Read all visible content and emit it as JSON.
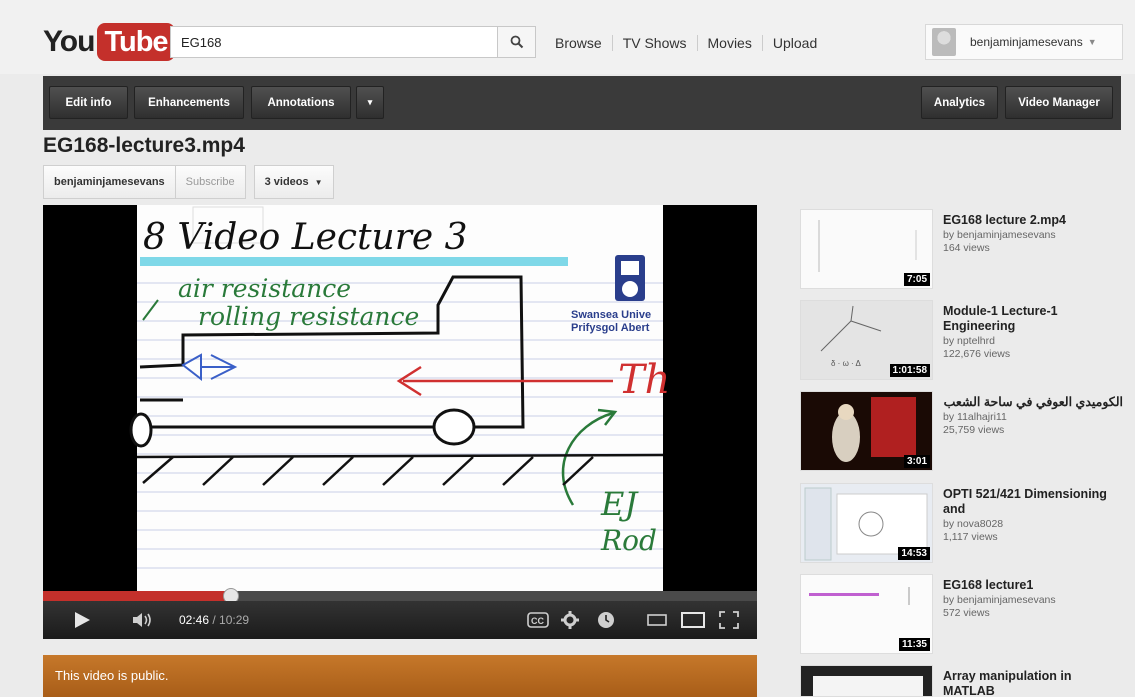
{
  "masthead": {
    "logo_you": "You",
    "logo_tube": "Tube",
    "search_value": "EG168",
    "nav": [
      "Browse",
      "TV Shows",
      "Movies",
      "Upload"
    ],
    "username": "benjaminjamesevans"
  },
  "toolbar": {
    "edit_info": "Edit info",
    "enhancements": "Enhancements",
    "annotations": "Annotations",
    "more_caret": "▾",
    "analytics": "Analytics",
    "video_manager": "Video Manager"
  },
  "video": {
    "title": "EG168-lecture3.mp4",
    "owner": "benjaminjamesevans",
    "subscribe": "Subscribe",
    "videos_count": "3 videos",
    "current_time": "02:46",
    "duration": " / 10:29",
    "progress_fraction": 0.264,
    "frame_text": {
      "heading": "8 Video Lecture 3",
      "line1": "air resistance",
      "line2": "rolling resistance",
      "uni1": "Swansea Unive",
      "uni2": "Prifysgol Abert",
      "th": "Th",
      "ej": "EJ",
      "rod": "Rod"
    },
    "status": "This video is public."
  },
  "related": [
    {
      "title": "EG168 lecture 2.mp4",
      "by": "by benjaminjamesevans",
      "views": "164 views",
      "duration": "7:05"
    },
    {
      "title": "Module-1 Lecture-1 Engineering",
      "by": "by nptelhrd",
      "views": "122,676 views",
      "duration": "1:01:58"
    },
    {
      "title": "الكوميدي العوفي في ساحة الشعب",
      "by": "by 11alhajri11",
      "views": "25,759 views",
      "duration": "3:01"
    },
    {
      "title": "OPTI 521/421 Dimensioning and",
      "by": "by nova8028",
      "views": "1,117 views",
      "duration": "14:53"
    },
    {
      "title": "EG168 lecture1",
      "by": "by benjaminjamesevans",
      "views": "572 views",
      "duration": "11:35"
    },
    {
      "title": "Array manipulation in MATLAB",
      "by": "",
      "views": "",
      "duration": ""
    }
  ],
  "colors": {
    "brand_red": "#c4302b",
    "public_bar": "#b5651d",
    "toolbar": "#3a3a3a"
  }
}
